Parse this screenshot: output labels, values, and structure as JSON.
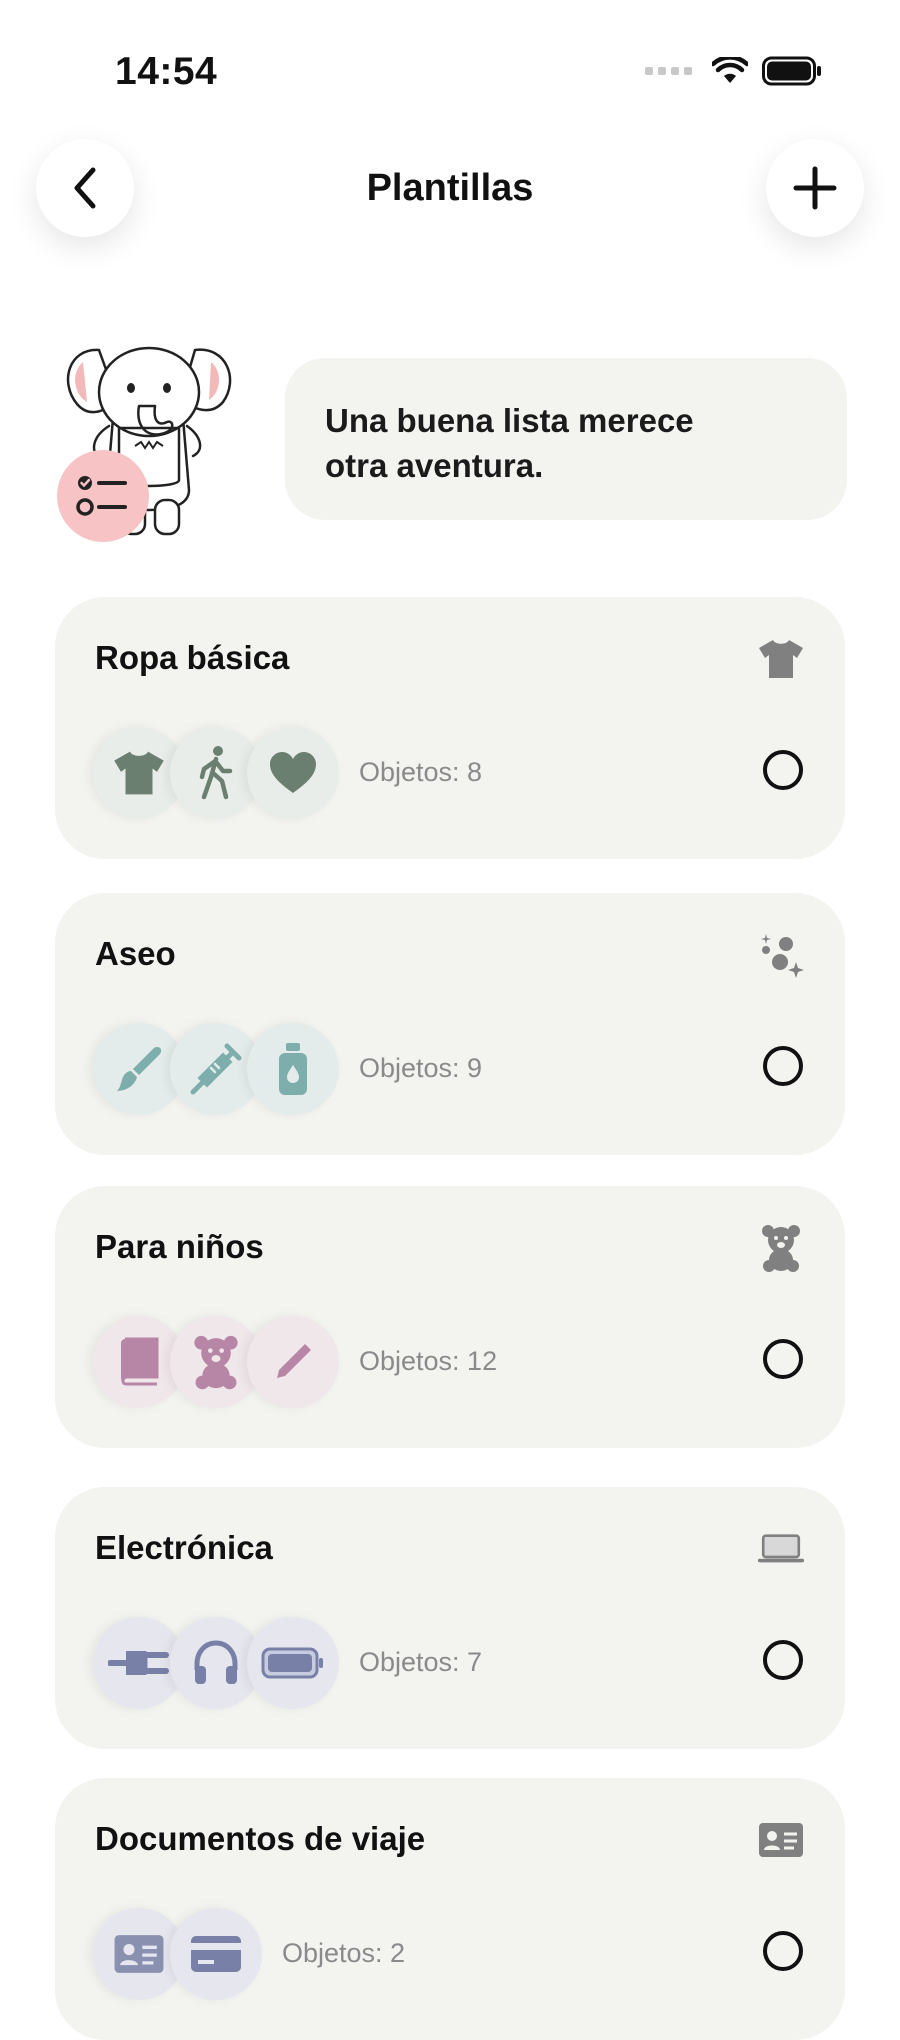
{
  "status_bar": {
    "time": "14:54"
  },
  "nav": {
    "title": "Plantillas"
  },
  "hero": {
    "message_line1": "Una buena lista merece",
    "message_line2": "otra aventura."
  },
  "colors": {
    "accent_pink": "#f7c3c4",
    "card_bg": "#f3f3f0",
    "green_icon": "#6b7f71",
    "teal_icon": "#7eaeab",
    "pink_icon": "#b785a5",
    "blue_icon": "#7880a8"
  },
  "templates": [
    {
      "title": "Ropa básica",
      "icon": "tshirt-icon",
      "items": [
        "tshirt-icon",
        "walking-icon",
        "heart-icon"
      ],
      "count": "Objetos: 8"
    },
    {
      "title": "Aseo",
      "icon": "sparkles-icon",
      "items": [
        "brush-icon",
        "syringe-icon",
        "bottle-icon"
      ],
      "count": "Objetos: 9"
    },
    {
      "title": "Para niños",
      "icon": "teddy-bear-icon",
      "items": [
        "book-icon",
        "teddy-bear-icon",
        "pencil-icon"
      ],
      "count": "Objetos: 12"
    },
    {
      "title": "Electrónica",
      "icon": "laptop-icon",
      "items": [
        "plug-icon",
        "headphones-icon",
        "battery-icon"
      ],
      "count": "Objetos: 7"
    },
    {
      "title": "Documentos de viaje",
      "icon": "id-card-icon",
      "items": [
        "id-card-icon",
        "credit-card-icon"
      ],
      "count": "Objetos: 2"
    }
  ]
}
